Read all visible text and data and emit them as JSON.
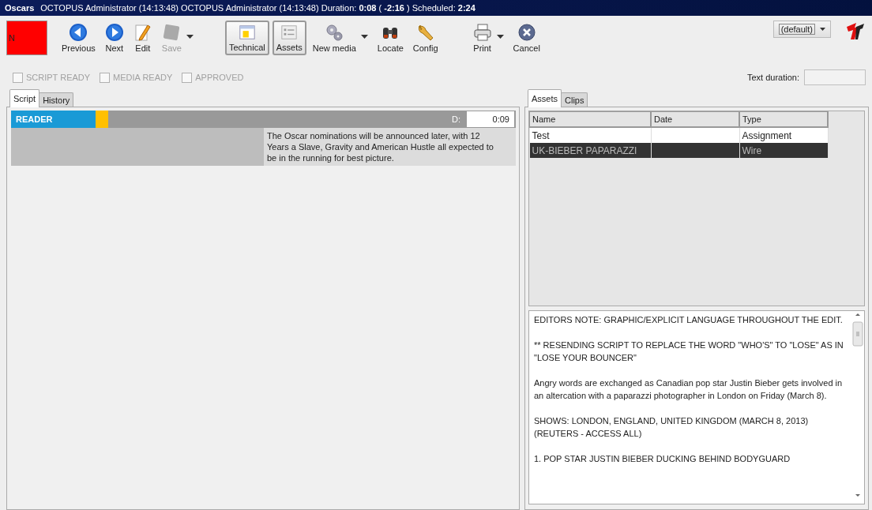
{
  "title_bar": {
    "app": "Oscars",
    "info": "OCTOPUS Administrator (14:13:48)   OCTOPUS Administrator (14:13:48) Duration: **0:08** ( **-2:16** ) Scheduled: **2:24**"
  },
  "status_swatch": {
    "label": "N"
  },
  "toolbar": [
    {
      "label": "Previous",
      "disabled": false,
      "pressed": false,
      "dropdown": false
    },
    {
      "label": "Next",
      "disabled": false,
      "pressed": false,
      "dropdown": false
    },
    {
      "label": "Edit",
      "disabled": false,
      "pressed": false,
      "dropdown": false
    },
    {
      "label": "Save",
      "disabled": true,
      "pressed": false,
      "dropdown": true
    },
    {
      "label": "Technical",
      "disabled": false,
      "pressed": true,
      "dropdown": false
    },
    {
      "label": "Assets",
      "disabled": false,
      "pressed": true,
      "dropdown": false
    },
    {
      "label": "New media",
      "disabled": false,
      "pressed": false,
      "dropdown": true
    },
    {
      "label": "Locate",
      "disabled": false,
      "pressed": false,
      "dropdown": false
    },
    {
      "label": "Config",
      "disabled": false,
      "pressed": false,
      "dropdown": false
    },
    {
      "label": "Print",
      "disabled": false,
      "pressed": false,
      "dropdown": true
    },
    {
      "label": "Cancel",
      "disabled": false,
      "pressed": false,
      "dropdown": false
    }
  ],
  "view_selector": {
    "value": "(default)"
  },
  "flags": [
    {
      "label": "SCRIPT READY",
      "checked": false,
      "disabled": true
    },
    {
      "label": "MEDIA READY",
      "checked": false,
      "disabled": true
    },
    {
      "label": "APPROVED",
      "checked": false,
      "disabled": true
    }
  ],
  "text_duration": {
    "label": "Text duration:"
  },
  "left_tabs": [
    {
      "label": "Script",
      "selected": true
    },
    {
      "label": "History",
      "selected": false
    }
  ],
  "script_blocks": [
    {
      "label": "READER",
      "color": "#ffc000",
      "duration_label": "D:",
      "duration": "0:09",
      "text": "The Oscar nominations will be announced later, with 12 Years a Slave, Gravity and American Hustle all expected to be in the running for best picture."
    }
  ],
  "right_tabs": [
    {
      "label": "Assets",
      "selected": true
    },
    {
      "label": "Clips",
      "selected": false
    }
  ],
  "assets_table": {
    "columns": [
      "Name",
      "Date",
      "Type"
    ],
    "rows": [
      {
        "name": "Test",
        "type": "Assignment",
        "selected": false
      },
      {
        "name": "UK-BIEBER PAPARAZZI",
        "type": "Wire",
        "selected": true
      }
    ]
  },
  "notes": [
    "EDITORS NOTE: GRAPHIC/EXPLICIT LANGUAGE THROUGHOUT THE EDIT.",
    "** RESENDING SCRIPT TO REPLACE THE WORD \"WHO'S\" TO \"LOSE\" AS IN \"LOSE YOUR BOUNCER\"",
    "Angry words are exchanged as Canadian pop star Justin Bieber gets involved in an altercation with a paparazzi photographer in London on Friday (March 8).",
    "SHOWS: LONDON, ENGLAND, UNITED KINGDOM (MARCH 8, 2013) (REUTERS - ACCESS ALL)",
    "1. POP STAR JUSTIN BIEBER DUCKING BEHIND BODYGUARD"
  ]
}
